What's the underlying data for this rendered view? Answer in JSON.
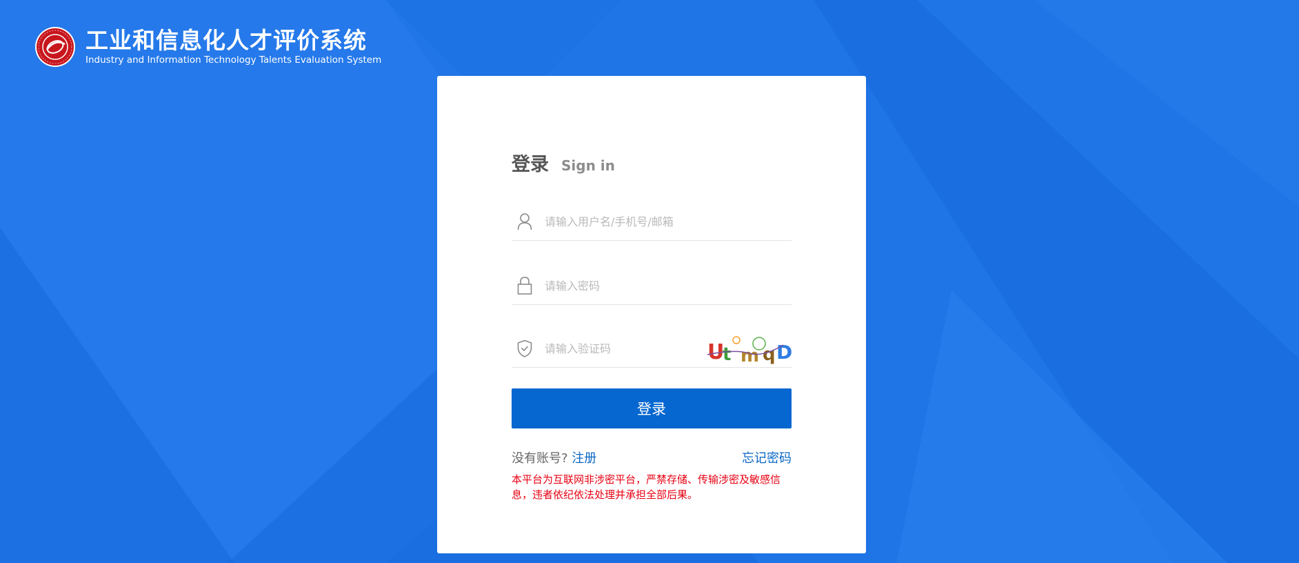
{
  "header": {
    "logo_icon": "seal-logo-icon",
    "title": "工业和信息化人才评价系统",
    "subtitle": "Industry and Information Technology Talents Evaluation System"
  },
  "login": {
    "title_cn": "登录",
    "title_en": "Sign in",
    "username": {
      "icon": "user-icon",
      "value": "",
      "placeholder": "请输入用户名/手机号/邮箱"
    },
    "password": {
      "icon": "lock-icon",
      "value": "",
      "placeholder": "请输入密码"
    },
    "captcha": {
      "icon": "shield-check-icon",
      "value": "",
      "placeholder": "请输入验证码",
      "image_text": "UtmqD"
    },
    "submit_label": "登录",
    "no_account_text": "没有账号?",
    "register_label": "注册",
    "forgot_label": "忘记密码",
    "notice": "本平台为互联网非涉密平台，严禁存储、传输涉密及敏感信息，违者依纪依法处理并承担全部后果。"
  },
  "colors": {
    "background": "#1f74e6",
    "primary": "#0667d0",
    "link": "#0a66c2",
    "notice": "#e60012"
  }
}
